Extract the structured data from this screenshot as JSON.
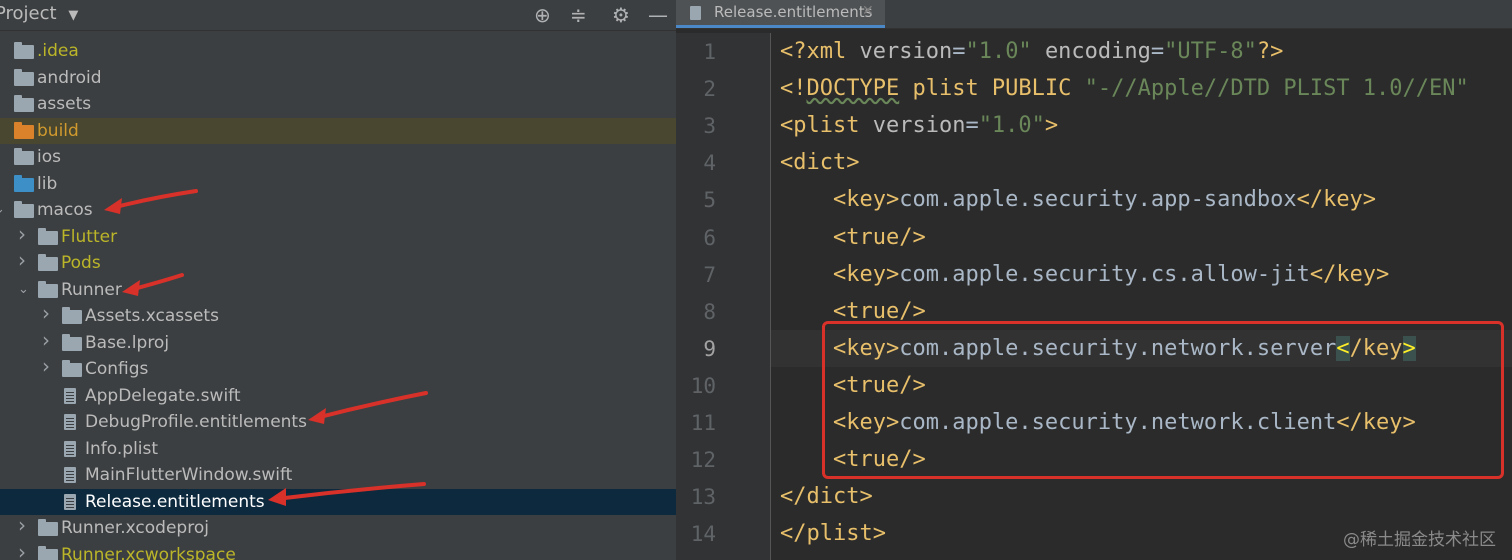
{
  "project_panel": {
    "title": "Project",
    "tree": [
      {
        "label": ".idea",
        "kind": "folder",
        "depth": 0,
        "arrow": "",
        "color": "#bbb529",
        "folder_color": "#9aa7b0"
      },
      {
        "label": "android",
        "kind": "folder",
        "depth": 0,
        "arrow": "",
        "color": "#bbbbbb",
        "folder_color": "#9aa7b0"
      },
      {
        "label": "assets",
        "kind": "folder",
        "depth": 0,
        "arrow": "",
        "color": "#bbbbbb",
        "folder_color": "#9aa7b0"
      },
      {
        "label": "build",
        "kind": "folder",
        "depth": 0,
        "arrow": "",
        "color": "#d19a2e",
        "folder_color": "#d9822b",
        "highlight": true
      },
      {
        "label": "ios",
        "kind": "folder",
        "depth": 0,
        "arrow": "",
        "color": "#bbbbbb",
        "folder_color": "#9aa7b0"
      },
      {
        "label": "lib",
        "kind": "folder",
        "depth": 0,
        "arrow": "",
        "color": "#bbbbbb",
        "folder_color": "#3d8fc7"
      },
      {
        "label": "macos",
        "kind": "folder",
        "depth": 0,
        "arrow": "expanded",
        "color": "#bbbbbb",
        "folder_color": "#9aa7b0"
      },
      {
        "label": "Flutter",
        "kind": "folder",
        "depth": 1,
        "arrow": "collapsed",
        "color": "#bbb529",
        "folder_color": "#9aa7b0"
      },
      {
        "label": "Pods",
        "kind": "folder",
        "depth": 1,
        "arrow": "collapsed",
        "color": "#bbb529",
        "folder_color": "#9aa7b0"
      },
      {
        "label": "Runner",
        "kind": "folder",
        "depth": 1,
        "arrow": "expanded",
        "color": "#bbbbbb",
        "folder_color": "#9aa7b0"
      },
      {
        "label": "Assets.xcassets",
        "kind": "folder",
        "depth": 2,
        "arrow": "collapsed",
        "color": "#bbbbbb",
        "folder_color": "#9aa7b0"
      },
      {
        "label": "Base.lproj",
        "kind": "folder",
        "depth": 2,
        "arrow": "collapsed",
        "color": "#bbbbbb",
        "folder_color": "#9aa7b0"
      },
      {
        "label": "Configs",
        "kind": "folder",
        "depth": 2,
        "arrow": "collapsed",
        "color": "#bbbbbb",
        "folder_color": "#9aa7b0"
      },
      {
        "label": "AppDelegate.swift",
        "kind": "file",
        "depth": 2,
        "arrow": "",
        "color": "#bbbbbb"
      },
      {
        "label": "DebugProfile.entitlements",
        "kind": "file",
        "depth": 2,
        "arrow": "",
        "color": "#bbbbbb"
      },
      {
        "label": "Info.plist",
        "kind": "file",
        "depth": 2,
        "arrow": "",
        "color": "#bbbbbb"
      },
      {
        "label": "MainFlutterWindow.swift",
        "kind": "file",
        "depth": 2,
        "arrow": "",
        "color": "#bbbbbb"
      },
      {
        "label": "Release.entitlements",
        "kind": "file",
        "depth": 2,
        "arrow": "",
        "color": "#ffffff",
        "selected": true
      },
      {
        "label": "Runner.xcodeproj",
        "kind": "folder",
        "depth": 1,
        "arrow": "collapsed",
        "color": "#bbbbbb",
        "folder_color": "#9aa7b0"
      },
      {
        "label": "Runner.xcworkspace",
        "kind": "folder",
        "depth": 1,
        "arrow": "collapsed",
        "color": "#bbb529",
        "folder_color": "#9aa7b0"
      }
    ]
  },
  "editor": {
    "tab_label": "Release.entitlements",
    "current_line": 9,
    "lines": [
      [
        [
          "tag",
          "<?xml "
        ],
        [
          "attr",
          "version"
        ],
        [
          "txt",
          "="
        ],
        [
          "str",
          "\"1.0\""
        ],
        [
          "txt",
          " "
        ],
        [
          "attr",
          "encoding"
        ],
        [
          "txt",
          "="
        ],
        [
          "str",
          "\"UTF-8\""
        ],
        [
          "tag",
          "?>"
        ]
      ],
      [
        [
          "tag",
          "<!"
        ],
        [
          "tag squiggle",
          "DOCTYPE"
        ],
        [
          "tag",
          " plist PUBLIC "
        ],
        [
          "str",
          "\"-//Apple//DTD PLIST 1.0//EN\""
        ]
      ],
      [
        [
          "tag",
          "<plist "
        ],
        [
          "attr",
          "version"
        ],
        [
          "txt",
          "="
        ],
        [
          "str",
          "\"1.0\""
        ],
        [
          "tag",
          ">"
        ]
      ],
      [
        [
          "tag",
          "<dict>"
        ]
      ],
      [
        [
          "txt",
          "    "
        ],
        [
          "tag",
          "<key>"
        ],
        [
          "txt",
          "com.apple.security.app-sandbox"
        ],
        [
          "tag",
          "</key>"
        ]
      ],
      [
        [
          "txt",
          "    "
        ],
        [
          "tag",
          "<true/>"
        ]
      ],
      [
        [
          "txt",
          "    "
        ],
        [
          "tag",
          "<key>"
        ],
        [
          "txt",
          "com.apple.security.cs.allow-jit"
        ],
        [
          "tag",
          "</key>"
        ]
      ],
      [
        [
          "txt",
          "    "
        ],
        [
          "tag",
          "<true/>"
        ]
      ],
      [
        [
          "txt",
          "    "
        ],
        [
          "tag",
          "<key>"
        ],
        [
          "txt",
          "com.apple.security.network.server"
        ],
        [
          "match",
          "<"
        ],
        [
          "tag",
          "/key"
        ],
        [
          "match",
          ">"
        ]
      ],
      [
        [
          "txt",
          "    "
        ],
        [
          "tag",
          "<true/>"
        ]
      ],
      [
        [
          "txt",
          "    "
        ],
        [
          "tag",
          "<key>"
        ],
        [
          "txt",
          "com.apple.security.network.client"
        ],
        [
          "tag",
          "</key>"
        ]
      ],
      [
        [
          "txt",
          "    "
        ],
        [
          "tag",
          "<true/>"
        ]
      ],
      [
        [
          "tag",
          "</dict>"
        ]
      ],
      [
        [
          "tag",
          "</plist>"
        ]
      ]
    ]
  },
  "watermark": "@稀土掘金技术社区",
  "colors": {
    "panel_bg": "#3c3f41",
    "editor_bg": "#2b2b2b",
    "selection_bg": "#0d293e",
    "build_row_bg": "#49472f",
    "annotation_red": "#d8312a"
  }
}
